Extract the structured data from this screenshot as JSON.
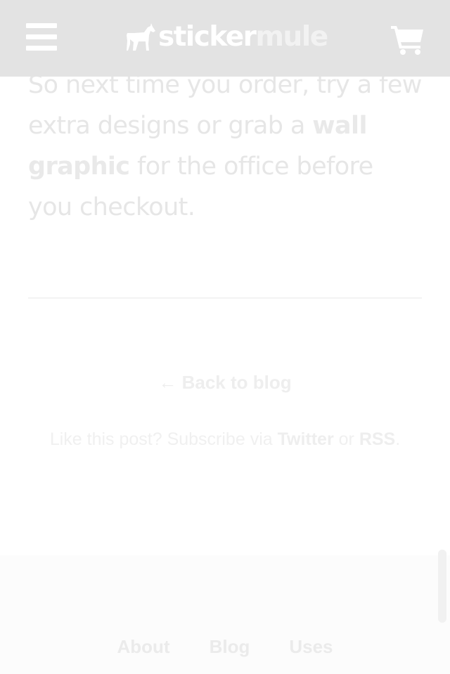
{
  "header": {
    "logo": {
      "word1": "sticker",
      "word2": "mule"
    },
    "menu_icon": "hamburger-menu-icon",
    "cart_icon": "shopping-cart-icon"
  },
  "article": {
    "p1": "So next time you order, try a few extra designs or grab a ",
    "link": "wall graphic",
    "p2": " for the office before you checkout."
  },
  "back": {
    "arrow": "←",
    "label": "Back to blog"
  },
  "subscribe": {
    "prefix": "Like this post? Subscribe via ",
    "twitter": "Twitter",
    "mid": " or ",
    "rss": "RSS",
    "suffix": "."
  },
  "footer": {
    "links": [
      "About",
      "Blog",
      "Uses"
    ]
  },
  "colors": {
    "header_bg": "#e3e3e3",
    "text": "#e6e6e6",
    "footer_bg": "#fcfcfc"
  }
}
